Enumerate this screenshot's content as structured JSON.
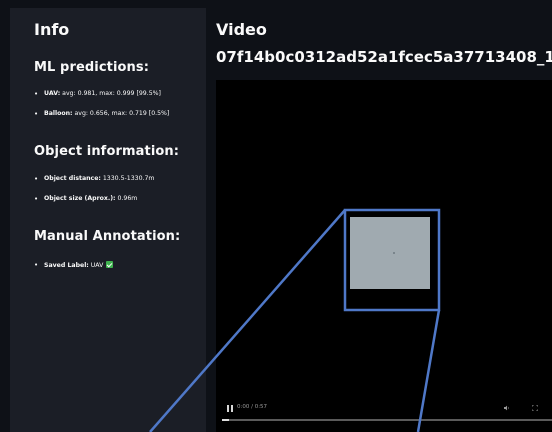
{
  "sidebar": {
    "title": "Info",
    "ml_predictions": {
      "heading": "ML predictions:",
      "items": [
        {
          "label": "UAV:",
          "value": "avg: 0.981, max: 0.999 [99.5%]"
        },
        {
          "label": "Balloon:",
          "value": "avg: 0.656, max: 0.719 [0.5%]"
        }
      ]
    },
    "object_information": {
      "heading": "Object information:",
      "items": [
        {
          "label": "Object distance:",
          "value": "1330.5-1330.7m"
        },
        {
          "label": "Object size (Aprox.):",
          "value": "0.96m"
        }
      ]
    },
    "manual_annotation": {
      "heading": "Manual Annotation:",
      "items": [
        {
          "label": "Saved Label:",
          "value": "UAV"
        }
      ]
    }
  },
  "main": {
    "title": "Video",
    "video_id": "07f14b0c0312ad52a1fcec5a37713408_1",
    "player": {
      "time": "0:00 / 0:57",
      "progress_fraction": 0.02
    }
  },
  "colors": {
    "background": "#0e1117",
    "sidebar": "#1b1e26",
    "zoom_box": "#4f78c8",
    "check": "#3fb34f"
  },
  "icons": [
    "pause-icon",
    "volume-icon",
    "fullscreen-icon",
    "check-icon"
  ]
}
